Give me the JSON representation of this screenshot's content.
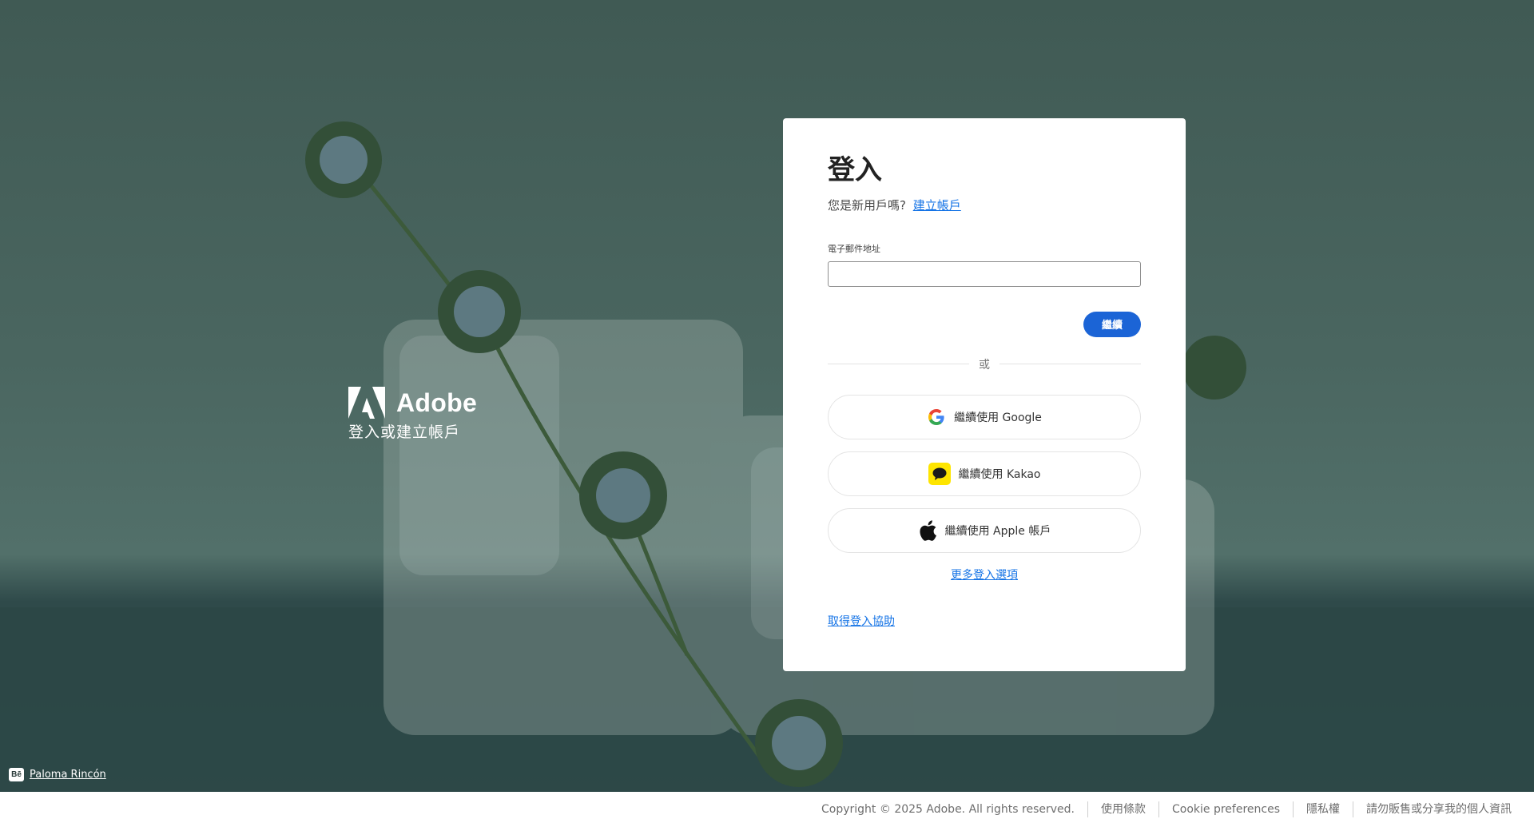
{
  "brand": {
    "name": "Adobe",
    "tagline": "登入或建立帳戶"
  },
  "credit": {
    "icon": "Bē",
    "name": "Paloma Rincón"
  },
  "signin": {
    "title": "登入",
    "new_user_prompt": "您是新用戶嗎?",
    "create_account": "建立帳戶",
    "email_label": "電子郵件地址",
    "email_value": "",
    "continue_label": "繼續",
    "or_label": "或",
    "google_label": "繼續使用 Google",
    "kakao_label": "繼續使用 Kakao",
    "apple_label": "繼續使用 Apple 帳戶",
    "more_options": "更多登入選項",
    "help": "取得登入協助"
  },
  "footer": {
    "copyright": "Copyright © 2025 Adobe. All rights reserved.",
    "terms": "使用條款",
    "cookie": "Cookie preferences",
    "privacy": "隱私權",
    "do_not_sell": "請勿販售或分享我的個人資訊"
  },
  "colors": {
    "accent": "#1b64d6",
    "link": "#1473e6",
    "kakao": "#fee500",
    "background": "#4a6660"
  }
}
